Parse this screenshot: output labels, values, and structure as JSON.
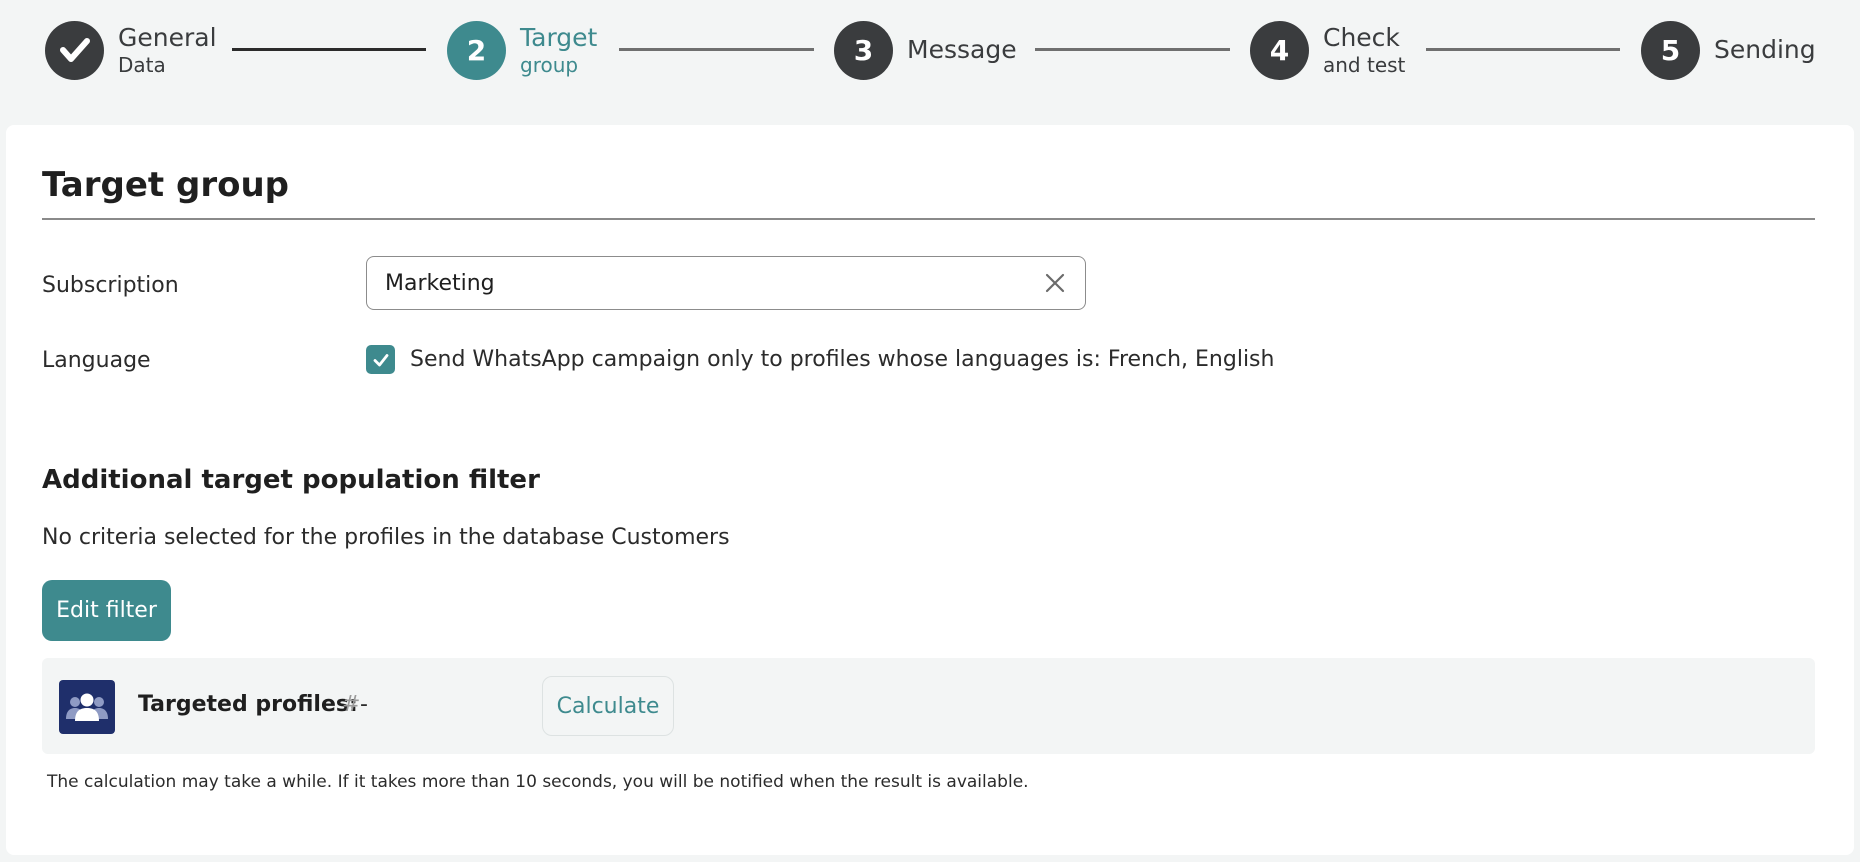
{
  "stepper": {
    "steps": [
      {
        "number": "",
        "title": "General",
        "subtitle": "Data",
        "state": "done"
      },
      {
        "number": "2",
        "title": "Target",
        "subtitle": "group",
        "state": "active"
      },
      {
        "number": "3",
        "title": "Message",
        "subtitle": "",
        "state": "pending"
      },
      {
        "number": "4",
        "title": "Check",
        "subtitle": "and test",
        "state": "pending"
      },
      {
        "number": "5",
        "title": "Sending",
        "subtitle": "",
        "state": "pending"
      }
    ]
  },
  "target_group": {
    "title": "Target group",
    "subscription": {
      "label": "Subscription",
      "value": "Marketing"
    },
    "language": {
      "label": "Language",
      "checked": true,
      "checkbox_text": "Send WhatsApp campaign only to profiles whose languages is: French, English"
    }
  },
  "filter": {
    "title": "Additional target population filter",
    "criteria_text": "No criteria selected for the profiles in the database Customers",
    "edit_label": "Edit filter"
  },
  "profiles": {
    "label": "Targeted profiles:",
    "hash": "#",
    "value": "-",
    "calculate_label": "Calculate",
    "note": "The calculation may take a while. If it takes more than 10 seconds, you will be notified when the result is available."
  },
  "colors": {
    "accent": "#3e8a8e",
    "step_dark": "#3a3c3e",
    "icon_bg": "#1f2f6b"
  }
}
